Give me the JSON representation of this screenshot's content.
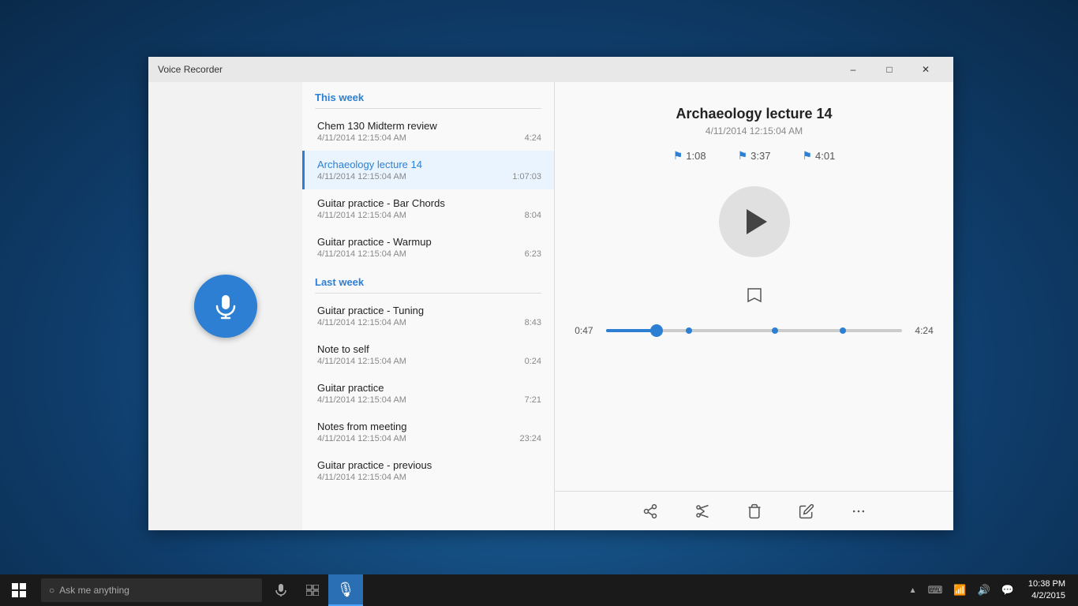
{
  "window": {
    "title": "Voice Recorder",
    "min_label": "–",
    "max_label": "□",
    "close_label": "✕"
  },
  "sections": [
    {
      "id": "this_week",
      "label": "This week",
      "recordings": [
        {
          "title": "Chem 130 Midterm review",
          "date": "4/11/2014 12:15:04 AM",
          "duration": "4:24",
          "active": false
        },
        {
          "title": "Archaeology lecture 14",
          "date": "4/11/2014 12:15:04 AM",
          "duration": "1:07:03",
          "active": true
        },
        {
          "title": "Guitar practice - Bar Chords",
          "date": "4/11/2014 12:15:04 AM",
          "duration": "8:04",
          "active": false
        },
        {
          "title": "Guitar practice - Warmup",
          "date": "4/11/2014 12:15:04 AM",
          "duration": "6:23",
          "active": false
        }
      ]
    },
    {
      "id": "last_week",
      "label": "Last week",
      "recordings": [
        {
          "title": "Guitar practice - Tuning",
          "date": "4/11/2014 12:15:04 AM",
          "duration": "8:43",
          "active": false
        },
        {
          "title": "Note to self",
          "date": "4/11/2014 12:15:04 AM",
          "duration": "0:24",
          "active": false
        },
        {
          "title": "Guitar practice",
          "date": "4/11/2014 12:15:04 AM",
          "duration": "7:21",
          "active": false
        },
        {
          "title": "Notes from meeting",
          "date": "4/11/2014 12:15:04 AM",
          "duration": "23:24",
          "active": false
        },
        {
          "title": "Guitar practice - previous",
          "date": "4/11/2014 12:15:04 AM",
          "duration": "",
          "active": false
        }
      ]
    }
  ],
  "player": {
    "title": "Archaeology lecture 14",
    "date": "4/11/2014 12:15:04 AM",
    "markers": [
      {
        "time": "1:08"
      },
      {
        "time": "3:37"
      },
      {
        "time": "4:01"
      }
    ],
    "current_time": "0:47",
    "total_time": "4:24",
    "progress_percent": 17
  },
  "toolbar": {
    "share_label": "share",
    "trim_label": "trim",
    "delete_label": "delete",
    "rename_label": "rename",
    "more_label": "more"
  },
  "taskbar": {
    "search_placeholder": "Ask me anything",
    "time": "10:38 PM",
    "date": "4/2/2015"
  }
}
